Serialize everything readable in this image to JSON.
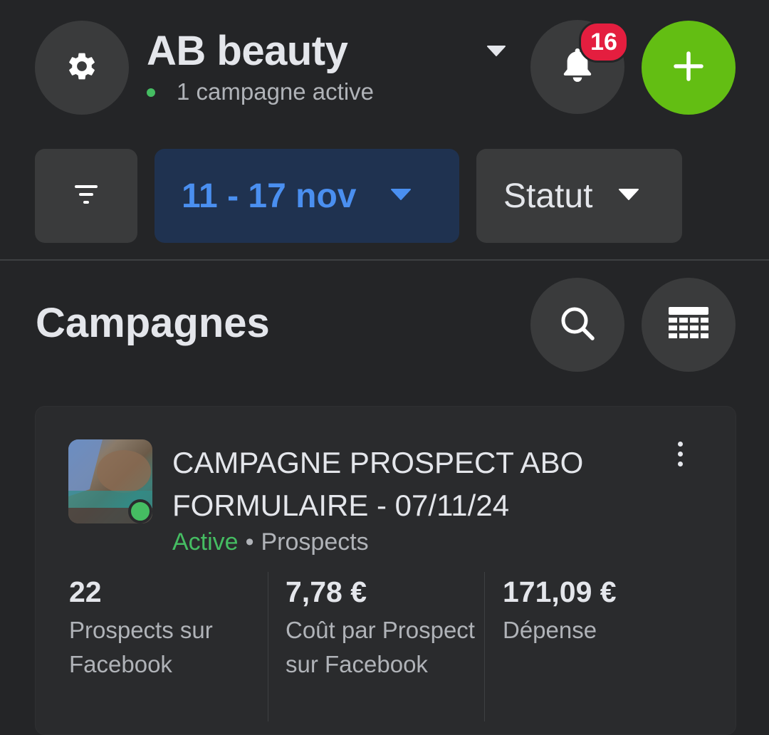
{
  "header": {
    "account_name": "AB beauty",
    "active_status": "1 campagne active",
    "notifications_count": "16"
  },
  "icons": {
    "settings": "gear-icon",
    "account_switch": "caret-down-icon",
    "notifications": "bell-icon",
    "create": "plus-icon",
    "filter": "filter-icon",
    "search": "search-icon",
    "columns": "table-columns-icon",
    "more": "more-vertical-icon"
  },
  "filters": {
    "date_range": "11 - 17 nov",
    "status_label": "Statut"
  },
  "section": {
    "title": "Campagnes"
  },
  "campaign": {
    "name": "CAMPAGNE PROSPECT ABO FORMULAIRE - 07/11/24",
    "status": "Active",
    "separator": "•",
    "objective": "Prospects",
    "metrics": [
      {
        "value": "22",
        "label": "Prospects sur Facebook"
      },
      {
        "value": "7,78 €",
        "label": "Coût par Prospect sur Facebook"
      },
      {
        "value": "171,09 €",
        "label": "Dépense"
      }
    ]
  },
  "colors": {
    "background": "#242527",
    "button": "#3a3b3c",
    "accent_green": "#63be13",
    "active_green": "#45bd62",
    "date_bg": "#1f3250",
    "date_text": "#4a8ff0",
    "badge_red": "#e41e3f"
  }
}
